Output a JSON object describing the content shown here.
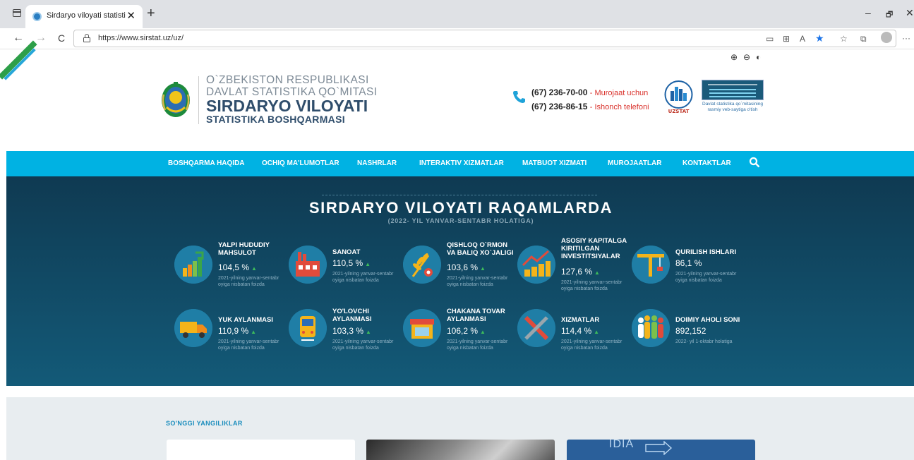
{
  "browser": {
    "tab_title": "Sirdaryo viloyati statistika boshqarmasi",
    "tab_close": "✕",
    "new_tab": "+",
    "url": "https://www.sirstat.uz/uz/",
    "win_min": "–",
    "win_max": "🗗",
    "win_close": "✕",
    "back": "←",
    "forward": "→",
    "refresh": "C",
    "more": "···"
  },
  "a11y": {
    "zoom_in": "⊕",
    "zoom_out": "⊖",
    "contrast": "◐"
  },
  "header": {
    "org_line1": "O`ZBEKISTON RESPUBLIKASI",
    "org_line2": "DAVLAT STATISTIKA QO`MITASI",
    "org_line3": "SIRDARYO VILOYATI",
    "org_line4": "STATISTIKA BOSHQARMASI",
    "phones": [
      {
        "number": "(67) 236-70-00",
        "label": "Murojaat uchun"
      },
      {
        "number": "(67) 236-86-15",
        "label": "Ishonch telefoni"
      }
    ],
    "uzstat_label": "UZSTAT",
    "banner_caption": "Davlat statistika qo`mitasining rasmiy veb-saytiga o'tish"
  },
  "nav": {
    "items": [
      "BOSHQARMA HAQIDA",
      "OCHIQ MA'LUMOTLAR",
      "NASHRLAR",
      "INTERAKTIV XIZMATLAR",
      "MATBUOT XIZMATI",
      "MUROJAATLAR",
      "KONTAKTLAR"
    ]
  },
  "stats": {
    "title": "SIRDARYO VILOYATI RAQAMLARDA",
    "subtitle": "(2022- YIL YANVAR-SENTABR HOLATIGA)",
    "items": [
      {
        "name": "YALPI HUDUDIY MAHSULOT",
        "value": "104,5 %",
        "note": "2021-yilning yanvar-sentabr oyiga nisbatan foizda",
        "icon": "chart-growth-icon",
        "trend_up": true
      },
      {
        "name": "SANOAT",
        "value": "110,5 %",
        "note": "2021-yilning yanvar-sentabr oyiga nisbatan foizda",
        "icon": "factory-icon",
        "trend_up": true
      },
      {
        "name": "QISHLOQ O`RMON VA BALIQ XO`JALIGI",
        "value": "103,6 %",
        "note": "2021-yilning yanvar-sentabr oyiga nisbatan foizda",
        "icon": "wheat-icon",
        "trend_up": true
      },
      {
        "name": "ASOSIY KAPITALGA KIRITILGAN INVESTITSIYALAR",
        "value": "127,6 %",
        "note": "2021-yilning yanvar-sentabr oyiga nisbatan foizda",
        "icon": "coins-chart-icon",
        "trend_up": true
      },
      {
        "name": "QURILISH ISHLARI",
        "value": "86,1 %",
        "note": "2021-yilning yanvar-sentabr oyiga nisbatan foizda",
        "icon": "crane-icon",
        "trend_up": false
      },
      {
        "name": "YUK AYLANMASI",
        "value": "110,9 %",
        "note": "2021-yilning yanvar-sentabr oyiga nisbatan foizda",
        "icon": "truck-icon",
        "trend_up": true
      },
      {
        "name": "YO'LOVCHI AYLANMASI",
        "value": "103,3 %",
        "note": "2021-yilning yanvar-sentabr oyiga nisbatan foizda",
        "icon": "train-icon",
        "trend_up": true
      },
      {
        "name": "CHAKANA TOVAR AYLANMASI",
        "value": "106,2 %",
        "note": "2021-yilning yanvar-sentabr oyiga nisbatan foizda",
        "icon": "shop-icon",
        "trend_up": true
      },
      {
        "name": "XIZMATLAR",
        "value": "114,4 %",
        "note": "2021-yilning yanvar-sentabr oyiga nisbatan foizda",
        "icon": "tools-icon",
        "trend_up": true
      },
      {
        "name": "DOIMIY AHOLI SONI",
        "value": "892,152",
        "note": "2022- yil 1-oktabr holatiga",
        "icon": "people-icon",
        "trend_up": false
      }
    ]
  },
  "news": {
    "heading": "SO'NGGI YANGILIKLAR",
    "card3_text": "IDIA"
  },
  "colors": {
    "nav_bg": "#00b2e3",
    "stats_bg": "#0f3a52",
    "accent_green": "#3dbb5c",
    "title_navy": "#2f4d6b",
    "alert_red": "#d9312b"
  }
}
